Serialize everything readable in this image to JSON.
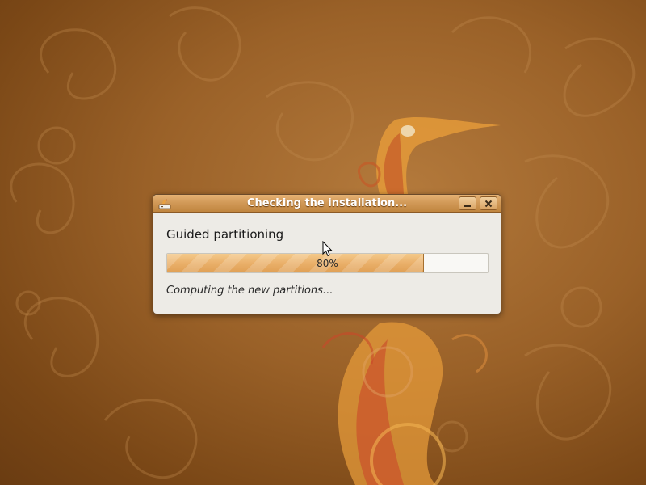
{
  "desktop": {
    "wallpaper_color": "#9a6128",
    "wallpaper_icon": "heron-artwork"
  },
  "dialog": {
    "title": "Checking the installation...",
    "window_icon": "installer-icon",
    "heading": "Guided partitioning",
    "progress": {
      "fraction": 0.8,
      "label": "80%"
    },
    "status_text": "Computing the new partitions...",
    "buttons": {
      "minimize_icon": "minimize-icon",
      "close_icon": "close-icon"
    }
  },
  "colors": {
    "titlebar": "#d29a58",
    "progress_fill": "#eab06a",
    "dialog_bg": "#edebe6"
  }
}
